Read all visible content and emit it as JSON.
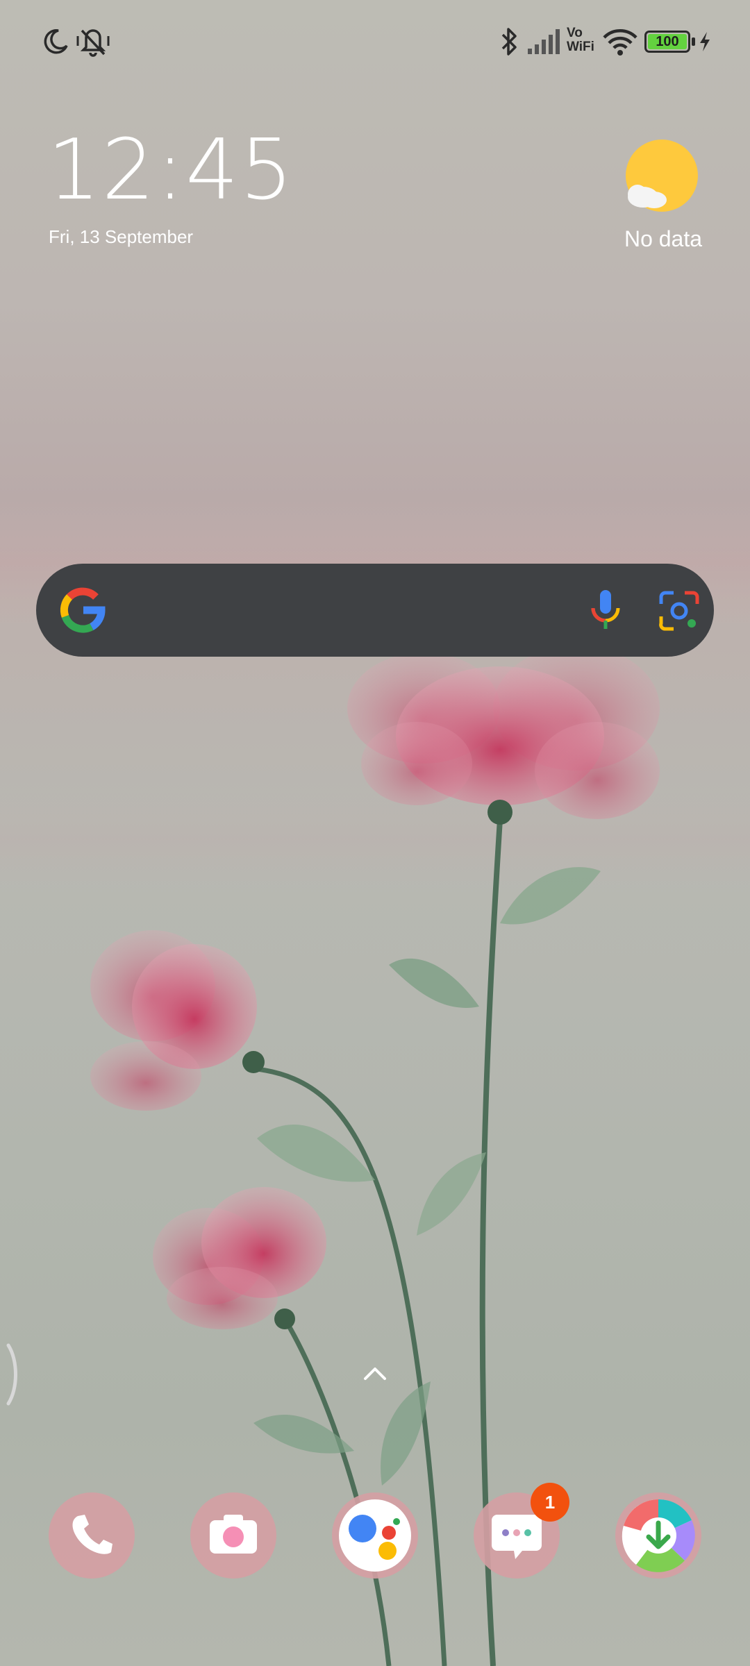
{
  "status_bar": {
    "left_icons": [
      "moon-icon",
      "vibrate-off-icon"
    ],
    "right_icons": [
      "bluetooth-icon",
      "signal-icon",
      "vowifi-icon",
      "wifi-icon",
      "battery-icon",
      "charging-icon"
    ],
    "vowifi_top": "Vo",
    "vowifi_bottom": "WiFi",
    "battery_level": "100"
  },
  "clock_widget": {
    "time": "12:45",
    "date": "Fri, 13 September"
  },
  "weather_widget": {
    "icon": "sun-cloud-icon",
    "status": "No data"
  },
  "search_widget": {
    "logo": "google-g-icon",
    "mic_icon": "microphone-icon",
    "lens_icon": "lens-camera-icon"
  },
  "app_drawer_hint": "chevron-up-icon",
  "dock": {
    "apps": [
      {
        "name": "phone",
        "icon": "phone-icon"
      },
      {
        "name": "camera",
        "icon": "camera-icon"
      },
      {
        "name": "assistant",
        "icon": "assistant-icon"
      },
      {
        "name": "messages",
        "icon": "messages-icon",
        "badge": "1"
      },
      {
        "name": "get-apps",
        "icon": "store-download-icon"
      }
    ]
  },
  "colors": {
    "search_bg": "#3f4144",
    "badge": "#f2510e",
    "battery_fill": "#63d23f",
    "weather_sun": "#fec93d"
  }
}
